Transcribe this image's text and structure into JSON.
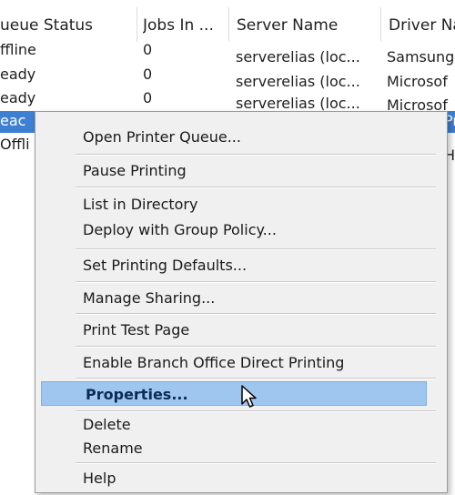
{
  "columns": [
    {
      "label": "ueue Status"
    },
    {
      "label": "Jobs In ..."
    },
    {
      "label": "Server Name"
    },
    {
      "label": "Driver Na"
    }
  ],
  "rows": [
    {
      "status": "ffline",
      "jobs": "0",
      "server": "serverelias (loc...",
      "driver": "Samsung"
    },
    {
      "status": "eady",
      "jobs": "0",
      "server": "serverelias (loc...",
      "driver": "Microsof"
    },
    {
      "status": "eady",
      "jobs": "0",
      "server": "serverelias (loc...",
      "driver": "Microsof"
    },
    {
      "status": "eac",
      "jobs": "",
      "server": "",
      "driver": "Pr"
    },
    {
      "status": "Offli",
      "jobs": "",
      "server": "",
      "driver": "H"
    }
  ],
  "context_menu": {
    "items": [
      {
        "label": "Open Printer Queue..."
      },
      {
        "label": "Pause Printing"
      },
      {
        "label": "List in Directory"
      },
      {
        "label": "Deploy with Group Policy..."
      },
      {
        "label": "Set Printing Defaults..."
      },
      {
        "label": "Manage Sharing..."
      },
      {
        "label": "Print Test Page"
      },
      {
        "label": "Enable Branch Office Direct Printing"
      },
      {
        "label": "Properties...",
        "highlighted": true
      },
      {
        "label": "Delete"
      },
      {
        "label": "Rename"
      },
      {
        "label": "Help"
      }
    ]
  },
  "colors": {
    "selection": "#3d7fd1",
    "menu_highlight": "#9ec6ee",
    "menu_background": "#f0f0f0"
  },
  "cursor": {
    "icon": "arrow-pointer-icon"
  }
}
